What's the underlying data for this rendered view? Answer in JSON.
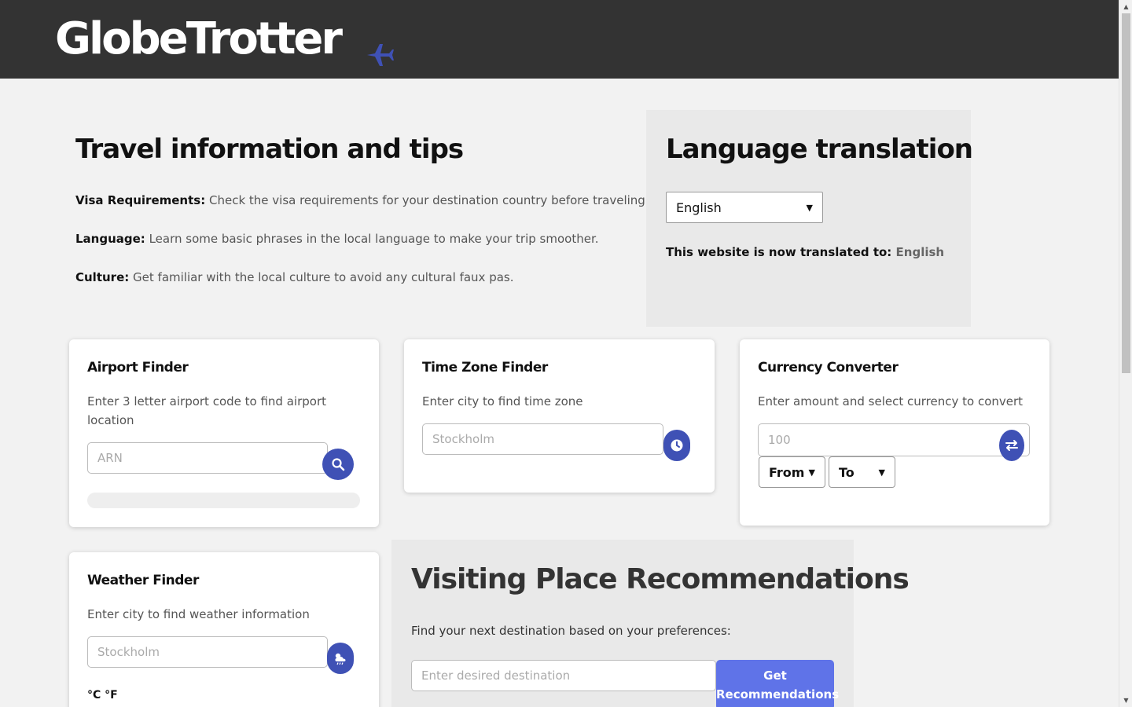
{
  "header": {
    "logo": "GlobeTrotter",
    "logo_icon": "airplane-icon",
    "colors": {
      "bar": "#333333",
      "accent": "#3f51b5"
    }
  },
  "travel_info": {
    "title": "Travel information and tips",
    "tips": [
      {
        "label": "Visa Requirements:",
        "text": "Check the visa requirements for your destination country before traveling."
      },
      {
        "label": "Language:",
        "text": "Learn some basic phrases in the local language to make your trip smoother."
      },
      {
        "label": "Culture:",
        "text": "Get familiar with the local culture to avoid any cultural faux pas."
      }
    ]
  },
  "language": {
    "title": "Language translation",
    "selected": "English",
    "status_label": "This website is now translated to:",
    "status_value": "English"
  },
  "airport_finder": {
    "title": "Airport Finder",
    "desc": "Enter 3 letter airport code to find airport location",
    "placeholder": "ARN",
    "button_icon": "search-icon"
  },
  "timezone_finder": {
    "title": "Time Zone Finder",
    "desc": "Enter city to find time zone",
    "placeholder": "Stockholm",
    "button_icon": "clock-icon"
  },
  "currency_converter": {
    "title": "Currency Converter",
    "desc": "Enter amount and select currency to convert",
    "placeholder": "100",
    "from": "From",
    "to": "To",
    "button_icon": "swap-icon"
  },
  "weather_finder": {
    "title": "Weather Finder",
    "desc": "Enter city to find weather information",
    "placeholder": "Stockholm",
    "units": "°C °F",
    "button_icon": "weather-icon"
  },
  "recommendations": {
    "title": "Visiting Place Recommendations",
    "desc": "Find your next destination based on your preferences:",
    "placeholder": "Enter desired destination",
    "button": "Get Recommendations",
    "button_color": "#5f73e8"
  }
}
